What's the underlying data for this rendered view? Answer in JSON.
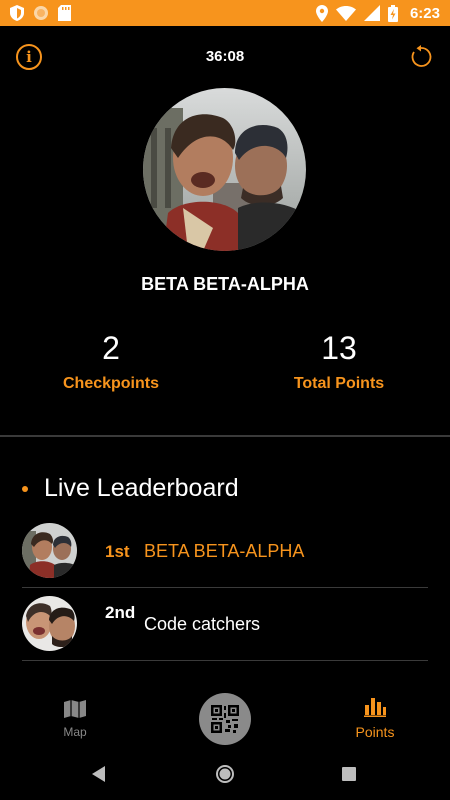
{
  "status_bar": {
    "time": "6:23",
    "icons": [
      "shield-icon",
      "circle-icon",
      "sd-card-icon",
      "location-icon",
      "wifi-icon",
      "signal-icon",
      "battery-charging-icon"
    ],
    "background": "#f7941d"
  },
  "header": {
    "timer": "36:08",
    "info_icon": "i"
  },
  "profile": {
    "team_name": "BETA BETA-ALPHA"
  },
  "stats": {
    "checkpoints_value": "2",
    "checkpoints_label": "Checkpoints",
    "points_value": "13",
    "points_label": "Total Points"
  },
  "leaderboard": {
    "title": "Live Leaderboard",
    "rows": [
      {
        "rank": "1st",
        "name": "BETA BETA-ALPHA",
        "highlight": true
      },
      {
        "rank": "2nd",
        "name": "Code catchers",
        "highlight": false
      }
    ]
  },
  "bottom_nav": {
    "map_label": "Map",
    "points_label": "Points",
    "scan_icon": "qr-code-icon"
  },
  "colors": {
    "accent": "#f7941d",
    "background": "#000000",
    "divider": "#3a3a3a"
  }
}
